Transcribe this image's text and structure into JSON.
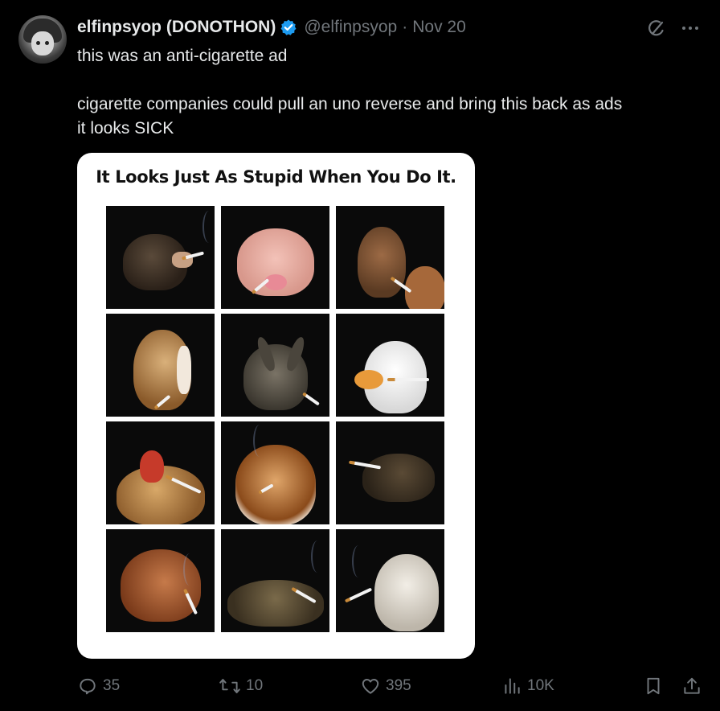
{
  "author": {
    "display_name": "elfinpsyop (DONOTHON)",
    "handle": "@elfinpsyop",
    "separator": "·",
    "date": "Nov 20",
    "verified": true,
    "verified_color": "#1d9bf0"
  },
  "tweet": {
    "line1": "this was an anti-cigarette ad",
    "line2": "cigarette companies could pull an uno reverse and bring this back as ads",
    "line3": "it looks SICK"
  },
  "media": {
    "poster_title": "It Looks Just As Stupid When You Do It.",
    "animals": [
      "chimpanzee",
      "pig",
      "deer",
      "horse",
      "rabbit",
      "duck",
      "rooster",
      "collie-dog",
      "lizard",
      "camel",
      "toad",
      "goat"
    ]
  },
  "actions": {
    "replies": "35",
    "reposts": "10",
    "likes": "395",
    "views": "10K"
  },
  "icons": {
    "grok": "grok-icon",
    "more": "more-icon",
    "reply": "reply-icon",
    "repost": "repost-icon",
    "like": "like-icon",
    "views": "views-icon",
    "bookmark": "bookmark-icon",
    "share": "share-icon"
  },
  "colors": {
    "background": "#000000",
    "text": "#e7e9ea",
    "secondary": "#71767b",
    "accent": "#1d9bf0"
  }
}
